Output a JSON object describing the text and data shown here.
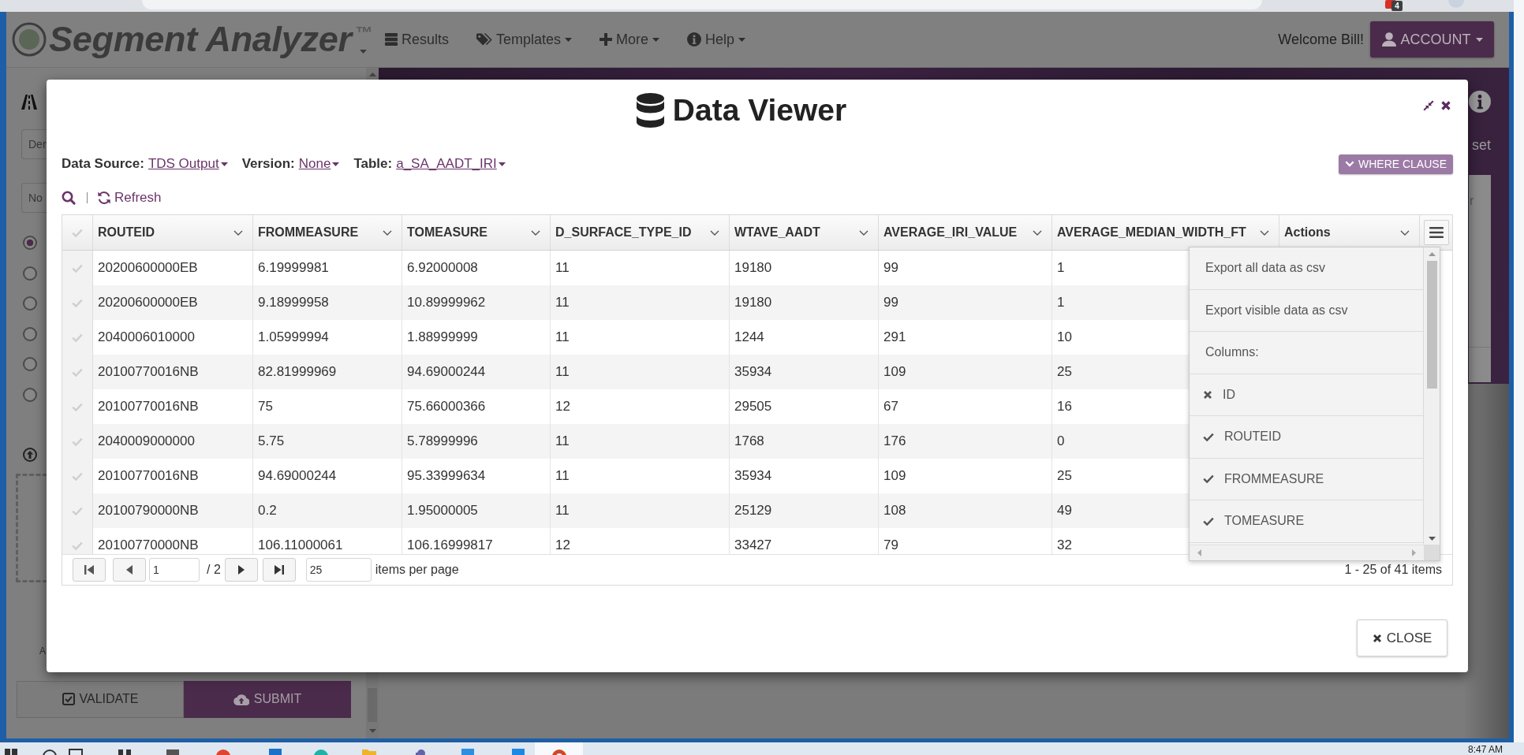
{
  "browser": {
    "extension_badge": "4"
  },
  "navbar": {
    "brand": "Segment Analyzer",
    "brand_mark": "™",
    "menu": [
      {
        "label": "Results",
        "dropdown": false
      },
      {
        "label": "Templates",
        "dropdown": true
      },
      {
        "label": "More",
        "dropdown": true
      },
      {
        "label": "Help",
        "dropdown": true
      }
    ],
    "welcome": "Welcome Bill!",
    "account_button": "ACCOUNT"
  },
  "left_panel": {
    "fields": [
      {
        "value": "Der"
      },
      {
        "value": "No"
      }
    ],
    "radios": [
      {
        "selected": true
      },
      {
        "selected": false
      },
      {
        "selected": false
      },
      {
        "selected": false
      },
      {
        "selected": false
      },
      {
        "selected": false
      }
    ],
    "note": "A",
    "buttons": [
      {
        "label": "VALIDATE",
        "kind": "default"
      },
      {
        "label": "SUBMIT",
        "kind": "primary"
      }
    ]
  },
  "right_panel": {
    "link": "set",
    "card_text": "r"
  },
  "data_viewer": {
    "title": "Data Viewer",
    "filters": [
      {
        "label": "Data Source:",
        "value": "TDS Output"
      },
      {
        "label": "Version:",
        "value": "None"
      },
      {
        "label": "Table:",
        "value": "a_SA_AADT_IRI"
      }
    ],
    "where_clause_button": "WHERE CLAUSE",
    "refresh": "Refresh",
    "grid": {
      "select_all": {
        "checked": false
      },
      "columns": [
        "ROUTEID",
        "FROMMEASURE",
        "TOMEASURE",
        "D_SURFACE_TYPE_ID",
        "WTAVE_AADT",
        "AVERAGE_IRI_VALUE",
        "AVERAGE_MEDIAN_WIDTH_FT",
        "Actions"
      ],
      "rows": [
        {
          "selected": false,
          "cells": [
            "20200600000EB",
            "6.19999981",
            "6.92000008",
            "11",
            "19180",
            "99",
            "1"
          ]
        },
        {
          "selected": false,
          "cells": [
            "20200600000EB",
            "9.18999958",
            "10.89999962",
            "11",
            "19180",
            "99",
            "1"
          ]
        },
        {
          "selected": false,
          "cells": [
            "2040006010000",
            "1.05999994",
            "1.88999999",
            "11",
            "1244",
            "291",
            "10"
          ]
        },
        {
          "selected": false,
          "cells": [
            "20100770016NB",
            "82.81999969",
            "94.69000244",
            "11",
            "35934",
            "109",
            "25"
          ]
        },
        {
          "selected": false,
          "cells": [
            "20100770016NB",
            "75",
            "75.66000366",
            "12",
            "29505",
            "67",
            "16"
          ]
        },
        {
          "selected": false,
          "cells": [
            "2040009000000",
            "5.75",
            "5.78999996",
            "11",
            "1768",
            "176",
            "0"
          ]
        },
        {
          "selected": false,
          "cells": [
            "20100770016NB",
            "94.69000244",
            "95.33999634",
            "11",
            "35934",
            "109",
            "25"
          ]
        },
        {
          "selected": false,
          "cells": [
            "20100790000NB",
            "0.2",
            "1.95000005",
            "11",
            "25129",
            "108",
            "49"
          ]
        },
        {
          "selected": false,
          "cells": [
            "20100770000NB",
            "106.11000061",
            "106.16999817",
            "12",
            "33427",
            "79",
            "32"
          ]
        }
      ],
      "pager": {
        "page": "1",
        "page_count": "/ 2",
        "page_size": "25",
        "page_size_label": "items per page",
        "summary": "1 - 25 of 41 items"
      }
    },
    "column_menu": [
      {
        "kind": "action",
        "label": "Export all data as csv"
      },
      {
        "kind": "action",
        "label": "Export visible data as csv"
      },
      {
        "kind": "heading",
        "label": "Columns:"
      },
      {
        "kind": "column",
        "label": "ID",
        "checked": false
      },
      {
        "kind": "column",
        "label": "ROUTEID",
        "checked": true
      },
      {
        "kind": "column",
        "label": "FROMMEASURE",
        "checked": true
      },
      {
        "kind": "column",
        "label": "TOMEASURE",
        "checked": true
      }
    ],
    "close_button": "CLOSE"
  },
  "taskbar": {
    "time": "8:47 AM"
  }
}
